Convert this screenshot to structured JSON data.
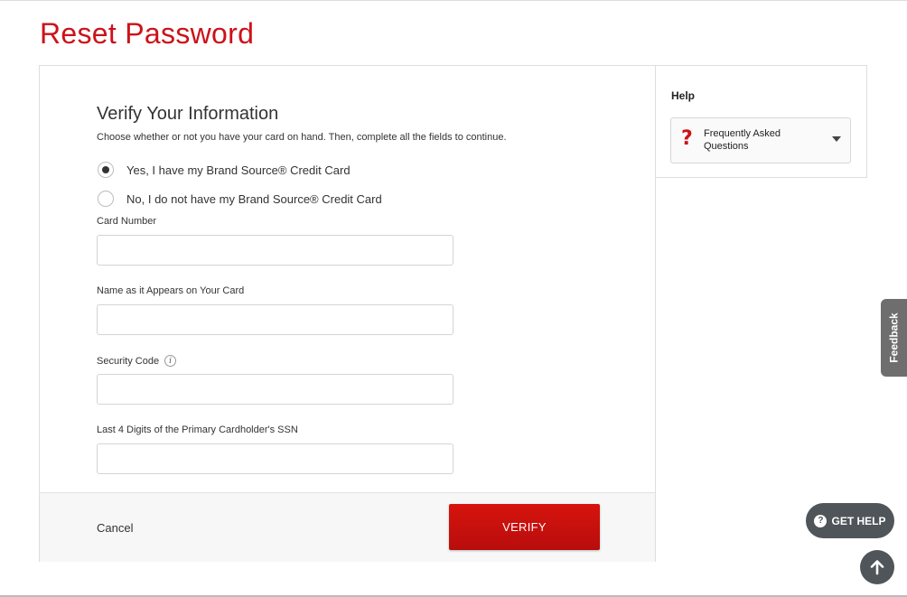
{
  "page": {
    "title": "Reset Password"
  },
  "form": {
    "heading": "Verify Your Information",
    "instructions": "Choose whether or not you have your card on hand. Then, complete all the fields to continue.",
    "options": [
      {
        "label": "Yes, I have my Brand Source® Credit Card",
        "selected": true
      },
      {
        "label": "No, I do not have my Brand Source® Credit Card",
        "selected": false
      }
    ],
    "fields": {
      "card_number": {
        "label": "Card Number",
        "value": ""
      },
      "name_on_card": {
        "label": "Name as it Appears on Your Card",
        "value": ""
      },
      "security_code": {
        "label": "Security Code",
        "value": "",
        "info_icon": "info-icon"
      },
      "ssn_last4": {
        "label": "Last 4 Digits of the Primary Cardholder's SSN",
        "value": ""
      }
    },
    "cancel_label": "Cancel",
    "verify_label": "VERIFY"
  },
  "help": {
    "title": "Help",
    "faq_icon": "?",
    "faq_label": "Frequently Asked Questions"
  },
  "widgets": {
    "feedback_label": "Feedback",
    "get_help_icon": "?",
    "get_help_label": "GET HELP",
    "scroll_top_icon": "arrow-up-icon"
  },
  "colors": {
    "brand_red": "#cc1219",
    "widget_gray": "#4f5559",
    "feedback_gray": "#6e6e6e"
  }
}
